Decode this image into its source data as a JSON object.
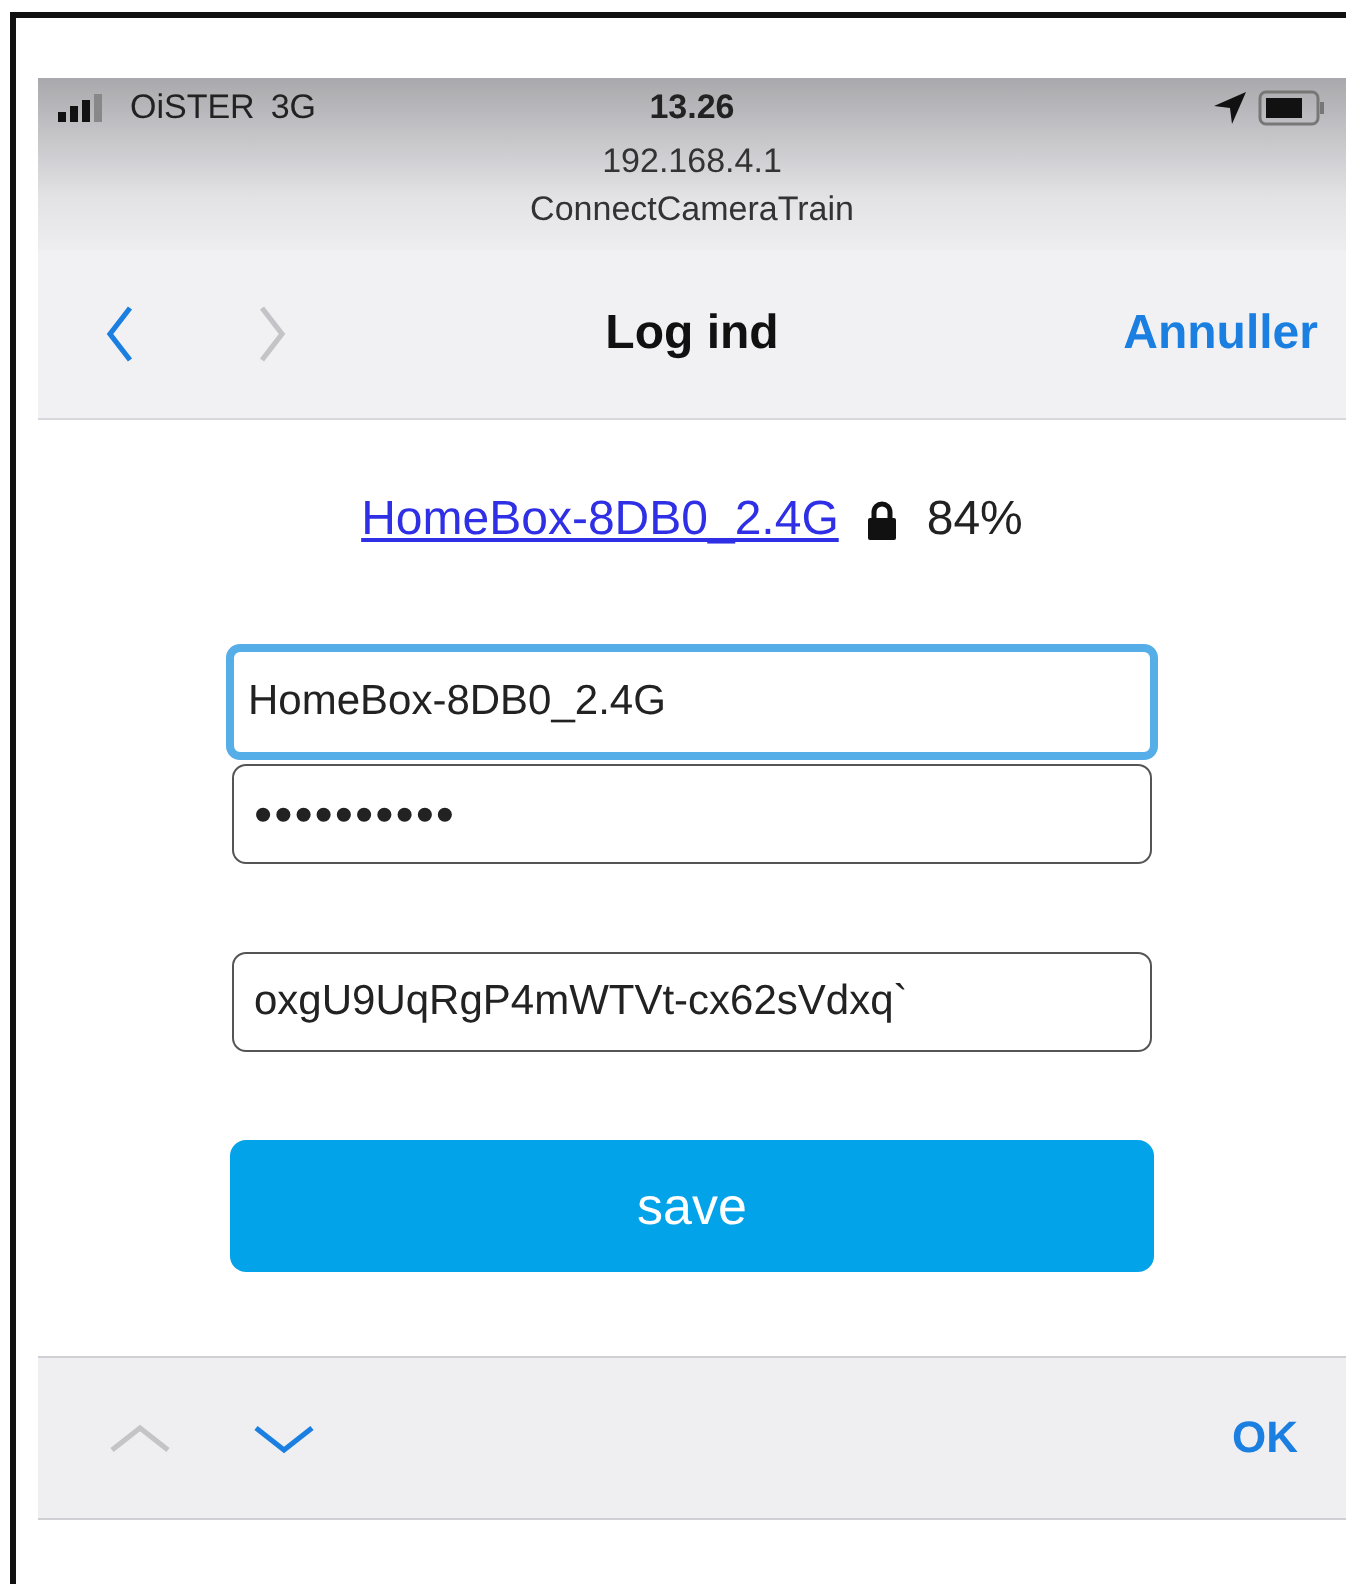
{
  "status_bar": {
    "carrier": "OiSTER",
    "network": "3G",
    "time": "13.26"
  },
  "address": {
    "host": "192.168.4.1",
    "page_title": "ConnectCameraTrain"
  },
  "nav": {
    "back": {
      "disabled": false
    },
    "forward": {
      "disabled": true
    },
    "title": "Log ind",
    "cancel": "Annuller"
  },
  "network": {
    "ssid": "HomeBox-8DB0_2.4G",
    "signal": "84%"
  },
  "fields": [
    {
      "kind": "text",
      "value": "HomeBox-8DB0_2.4G",
      "focused": true
    },
    {
      "kind": "password",
      "value": "••••••••••",
      "focused": false
    },
    {
      "kind": "text",
      "value": "oxgU9UqRgP4mWTVt-cx62sVdxq`",
      "focused": false
    }
  ],
  "save_button": "save",
  "keyboard_toolbar": {
    "previous": {
      "disabled": true
    },
    "next": {
      "disabled": false
    },
    "done": "OK"
  }
}
